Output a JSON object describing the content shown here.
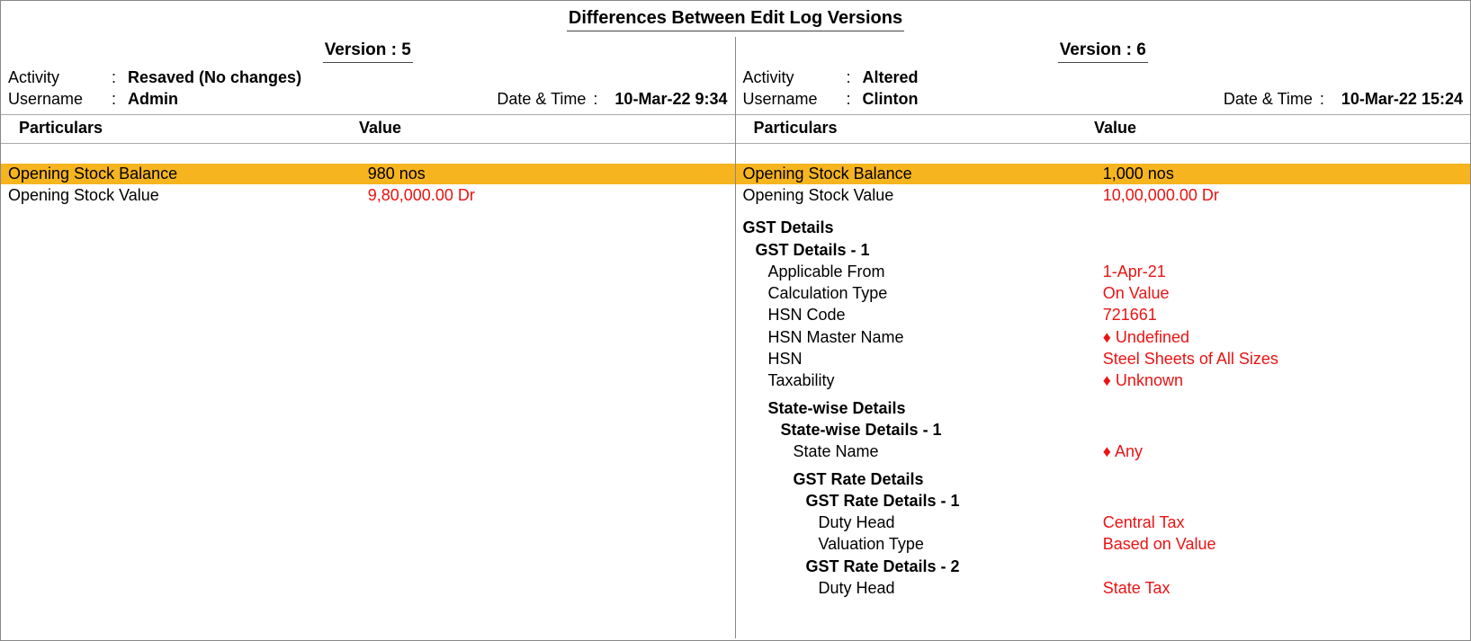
{
  "title": "Differences Between Edit Log Versions",
  "labels": {
    "version_prefix": "Version : ",
    "activity": "Activity",
    "username": "Username",
    "datetime": "Date & Time",
    "colon": ":",
    "particulars": "Particulars",
    "value": "Value"
  },
  "left": {
    "version": "5",
    "activity": "Resaved (No changes)",
    "username": "Admin",
    "datetime": "10-Mar-22 9:34",
    "opening_stock_balance_label": "Opening Stock Balance",
    "opening_stock_balance_value": "980 nos",
    "opening_stock_value_label": "Opening Stock Value",
    "opening_stock_value_value": "9,80,000.00 Dr"
  },
  "right": {
    "version": "6",
    "activity": "Altered",
    "username": "Clinton",
    "datetime": "10-Mar-22 15:24",
    "opening_stock_balance_label": "Opening Stock Balance",
    "opening_stock_balance_value": "1,000 nos",
    "opening_stock_value_label": "Opening Stock Value",
    "opening_stock_value_value": "10,00,000.00 Dr",
    "gst_details": "GST Details",
    "gst_details_1": "GST Details - 1",
    "applicable_from_label": "Applicable From",
    "applicable_from_value": "1-Apr-21",
    "calculation_type_label": "Calculation Type",
    "calculation_type_value": "On Value",
    "hsn_code_label": "HSN Code",
    "hsn_code_value": "721661",
    "hsn_master_label": "HSN Master Name",
    "hsn_master_value": "♦ Undefined",
    "hsn_label": "HSN",
    "hsn_value": "Steel Sheets of All Sizes",
    "taxability_label": "Taxability",
    "taxability_value": "♦ Unknown",
    "statewise_details": "State-wise Details",
    "statewise_details_1": "State-wise Details - 1",
    "state_name_label": "State Name",
    "state_name_value": "♦ Any",
    "gst_rate_details": "GST Rate Details",
    "gst_rate_details_1": "GST Rate Details - 1",
    "duty_head_label": "Duty Head",
    "duty_head_value_1": "Central Tax",
    "valuation_type_label": "Valuation Type",
    "valuation_type_value": "Based on Value",
    "gst_rate_details_2": "GST Rate Details - 2",
    "duty_head_value_2": "State Tax"
  }
}
